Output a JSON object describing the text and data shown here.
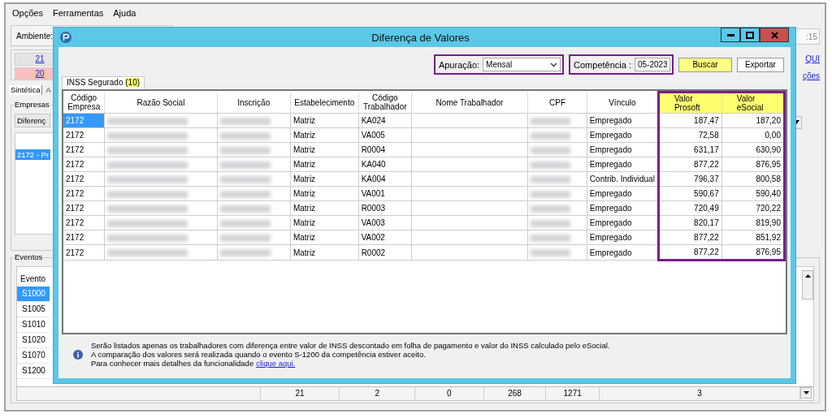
{
  "menu": [
    {
      "label": "Opções"
    },
    {
      "label": "Ferramentas"
    },
    {
      "label": "Ajuda"
    }
  ],
  "main": {
    "environment_label": "Ambiente:",
    "time_field": ":15",
    "counters": [
      {
        "label": "21",
        "kind": "neutral"
      },
      {
        "label": "20",
        "kind": "alert"
      }
    ],
    "links": [
      "QUI",
      "ções"
    ],
    "tabs": [
      {
        "label": "Sintética",
        "selected": true
      },
      {
        "label": "A",
        "selected": false
      }
    ],
    "companies": {
      "legend": "Empresas",
      "button": "Diferenç",
      "items": [
        {
          "label": "2172 - Pr",
          "selected": true
        }
      ]
    },
    "events": {
      "legend": "Eventos",
      "column": "Evento",
      "items": [
        {
          "label": "S1000",
          "selected": true
        },
        {
          "label": "S1005",
          "selected": false
        },
        {
          "label": "S1010",
          "selected": false
        },
        {
          "label": "S1020",
          "selected": false
        },
        {
          "label": "S1070",
          "selected": false
        },
        {
          "label": "S1200",
          "selected": false
        }
      ],
      "totals": [
        "21",
        "2",
        "0",
        "268",
        "1271",
        "3"
      ]
    }
  },
  "dialog": {
    "title": "Diferença de Valores",
    "apuracao": {
      "label": "Apuração:",
      "value": "Mensal"
    },
    "competencia": {
      "label": "Competência :",
      "value": "05-2023"
    },
    "buttons": [
      {
        "label": "Buscar",
        "kind": "primary"
      },
      {
        "label": "Exportar",
        "kind": "normal"
      }
    ],
    "tabs": [
      {
        "label": "INSS Segurado",
        "count": "(10)",
        "selected": true
      }
    ],
    "columns": [
      {
        "label": "Código Empresa",
        "kind": "text",
        "highlighted": false
      },
      {
        "label": "Razão Social",
        "kind": "redacted",
        "highlighted": false
      },
      {
        "label": "Inscrição",
        "kind": "redacted",
        "highlighted": false
      },
      {
        "label": "Estabelecimento",
        "kind": "text",
        "highlighted": false
      },
      {
        "label": "Código Trabalhador",
        "kind": "text",
        "highlighted": false
      },
      {
        "label": "Nome Trabalhador",
        "kind": "blank",
        "highlighted": false
      },
      {
        "label": "CPF",
        "kind": "redacted",
        "highlighted": false
      },
      {
        "label": "Vínculo",
        "kind": "text",
        "highlighted": false
      },
      {
        "label": "Valor Prosoft",
        "kind": "number",
        "highlighted": true
      },
      {
        "label": "Valor eSocial",
        "kind": "number",
        "highlighted": true
      }
    ],
    "rows": [
      {
        "selected": true,
        "cells": [
          "2172",
          "",
          "",
          "Matriz",
          "KA024",
          "",
          "",
          "Empregado",
          "187,47",
          "187,20"
        ]
      },
      {
        "selected": false,
        "cells": [
          "2172",
          "",
          "",
          "Matriz",
          "VA005",
          "",
          "",
          "Empregado",
          "72,58",
          "0,00"
        ]
      },
      {
        "selected": false,
        "cells": [
          "2172",
          "",
          "",
          "Matriz",
          "R0004",
          "",
          "",
          "Empregado",
          "631,17",
          "630,90"
        ]
      },
      {
        "selected": false,
        "cells": [
          "2172",
          "",
          "",
          "Matriz",
          "KA040",
          "",
          "",
          "Empregado",
          "877,22",
          "876,95"
        ]
      },
      {
        "selected": false,
        "cells": [
          "2172",
          "",
          "",
          "Matriz",
          "KA004",
          "",
          "",
          "Contrib. Individual",
          "796,37",
          "800,58"
        ]
      },
      {
        "selected": false,
        "cells": [
          "2172",
          "",
          "",
          "Matriz",
          "VA001",
          "",
          "",
          "Empregado",
          "590,67",
          "590,40"
        ]
      },
      {
        "selected": false,
        "cells": [
          "2172",
          "",
          "",
          "Matriz",
          "R0003",
          "",
          "",
          "Empregado",
          "720,49",
          "720,22"
        ]
      },
      {
        "selected": false,
        "cells": [
          "2172",
          "",
          "",
          "Matriz",
          "VA003",
          "",
          "",
          "Empregado",
          "820,17",
          "819,90"
        ]
      },
      {
        "selected": false,
        "cells": [
          "2172",
          "",
          "",
          "Matriz",
          "VA002",
          "",
          "",
          "Empregado",
          "877,22",
          "851,92"
        ]
      },
      {
        "selected": false,
        "cells": [
          "2172",
          "",
          "",
          "Matriz",
          "R0002",
          "",
          "",
          "Empregado",
          "877,22",
          "876,95"
        ]
      }
    ],
    "info": {
      "lines": [
        "Serão listados apenas os trabalhadores com diferença entre valor de INSS descontado em folha de pagamento e valor do INSS calculado pelo eSocial.",
        "A comparação dos valores será realizada quando o evento S-1200 da competência estiver aceito.",
        "Para conhecer mais detalhes da funcionalidade"
      ],
      "link": "clique aqui."
    }
  }
}
